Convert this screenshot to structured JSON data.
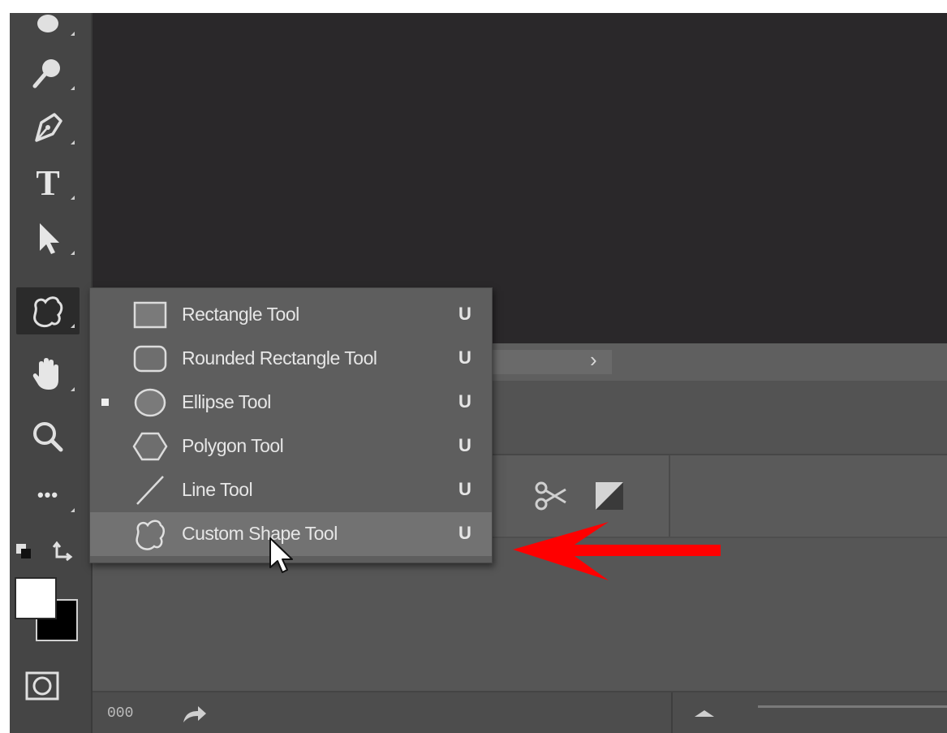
{
  "toolbar": {
    "tools": [
      {
        "name": "blur-tool",
        "icon": "droplet-icon"
      },
      {
        "name": "dodge-tool",
        "icon": "dodge-icon"
      },
      {
        "name": "pen-tool",
        "icon": "pen-icon"
      },
      {
        "name": "type-tool",
        "icon": "type-icon",
        "glyph": "T"
      },
      {
        "name": "path-selection-tool",
        "icon": "arrow-cursor-icon"
      },
      {
        "name": "shape-tool",
        "icon": "custom-shape-icon",
        "active": true
      },
      {
        "name": "hand-tool",
        "icon": "hand-icon"
      },
      {
        "name": "zoom-tool",
        "icon": "magnifier-icon"
      },
      {
        "name": "edit-toolbar",
        "icon": "more-icon",
        "glyph": "•••"
      }
    ],
    "foreground_color": "#ffffff",
    "background_color": "#000000"
  },
  "flyout": {
    "items": [
      {
        "label": "Rectangle Tool",
        "shortcut": "U",
        "icon": "rectangle-icon",
        "selected": false,
        "hover": false
      },
      {
        "label": "Rounded Rectangle Tool",
        "shortcut": "U",
        "icon": "rounded-rectangle-icon",
        "selected": false,
        "hover": false
      },
      {
        "label": "Ellipse Tool",
        "shortcut": "U",
        "icon": "ellipse-icon",
        "selected": true,
        "hover": false
      },
      {
        "label": "Polygon Tool",
        "shortcut": "U",
        "icon": "polygon-icon",
        "selected": false,
        "hover": false
      },
      {
        "label": "Line Tool",
        "shortcut": "U",
        "icon": "line-icon",
        "selected": false,
        "hover": false
      },
      {
        "label": "Custom Shape Tool",
        "shortcut": "U",
        "icon": "custom-shape-icon",
        "selected": false,
        "hover": true
      }
    ]
  },
  "status": {
    "code": "000"
  },
  "annotation": {
    "arrow_color": "#ff0000"
  }
}
